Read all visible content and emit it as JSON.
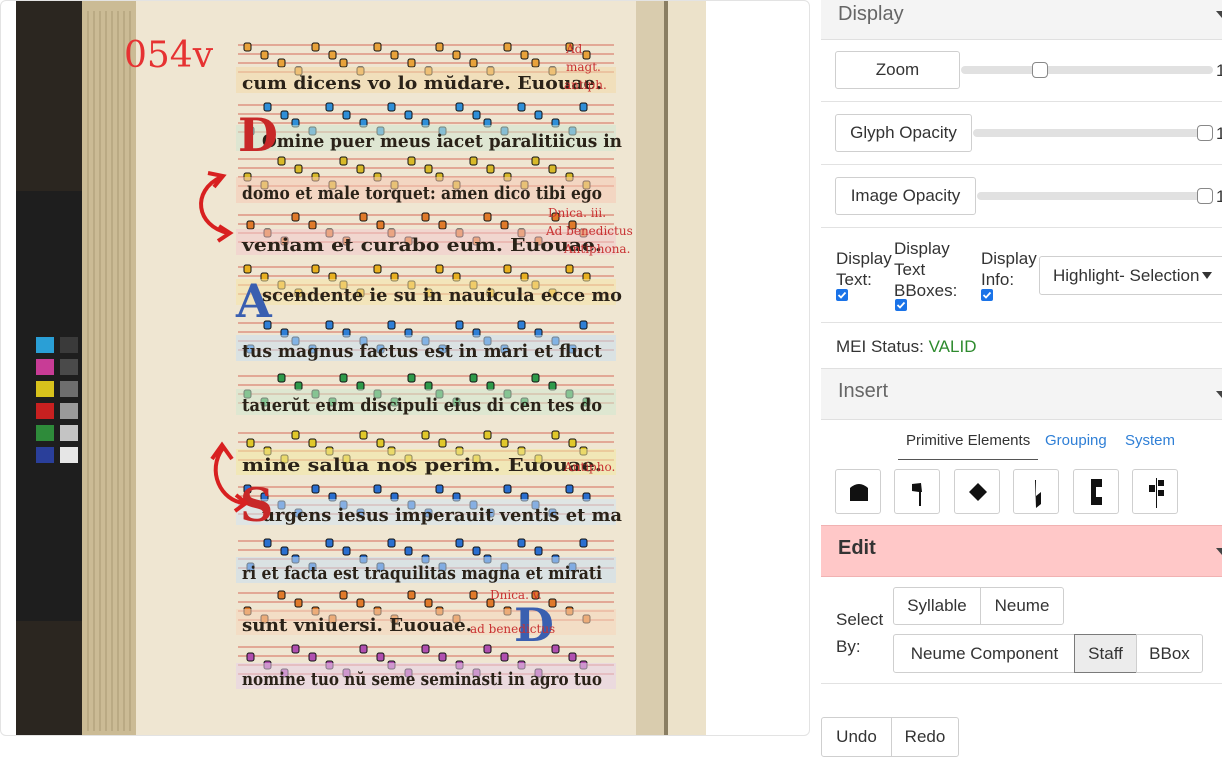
{
  "manuscript": {
    "folio_label": "054v",
    "lines": [
      "cum dicens vo lo mŭdare. Euouae.",
      "Omine puer meus iacet paralitiicus in",
      "domo et male torquet: amen dico tibi ego",
      "veniam et curabo eum. Euouae.",
      "scendente ie su in nauicula ecce mo",
      "tus magnus factus est in mari et fluct",
      "tauerŭt eum discipuli eius di cen tes do",
      "mine salua nos perim. Euouae.",
      "urgens iesus imperauit ventis et ma",
      "ri et facta est traquilitas magna et mirati",
      "sunt vniuersi. Euouae.",
      "omine",
      "nomine tuo nŭ seme seminasti in agro tuo"
    ],
    "margin_notes": [
      "Ad",
      "magt.",
      "antiph.",
      "Dnica. iii.",
      "Ad benedictus",
      "Antiphona.",
      "Antipho.",
      "Dnica. v.",
      "ad benedictus"
    ]
  },
  "display": {
    "title": "Display",
    "zoom_label": "Zoom",
    "zoom_value": 0.3,
    "glyph_opacity_label": "Glyph Opacity",
    "glyph_opacity_value": 1.0,
    "image_opacity_label": "Image Opacity",
    "image_opacity_value": 1.0,
    "slider_end_text": "1",
    "display_text_label": "Display Text:",
    "display_text_checked": true,
    "display_bboxes_label": "Display Text BBoxes:",
    "display_bboxes_checked": true,
    "display_info_label": "Display Info:",
    "display_info_checked": true,
    "highlight_select": "Highlight- Selection",
    "mei_status_label": "MEI Status:",
    "mei_status_value": "VALID",
    "status_color": "#2e8b2e"
  },
  "insert": {
    "title": "Insert",
    "tabs": [
      "Primitive Elements",
      "Grouping",
      "System"
    ],
    "active_tab": "Primitive Elements",
    "tools": [
      "punctum-icon",
      "virga-icon",
      "diamond-icon",
      "custos-icon",
      "clef-c-icon",
      "clef-f-icon"
    ]
  },
  "edit": {
    "title": "Edit",
    "header_color": "#ffc8c8",
    "select_by_label": "Select By:",
    "options": [
      "Syllable",
      "Neume",
      "Neume Component",
      "Staff",
      "BBox"
    ],
    "selected": "Staff"
  },
  "history": {
    "undo": "Undo",
    "redo": "Redo"
  },
  "colors": {
    "accent_blue": "#1a73e8",
    "link_blue": "#2f7fd6",
    "valid_green": "#2e8b2e"
  }
}
